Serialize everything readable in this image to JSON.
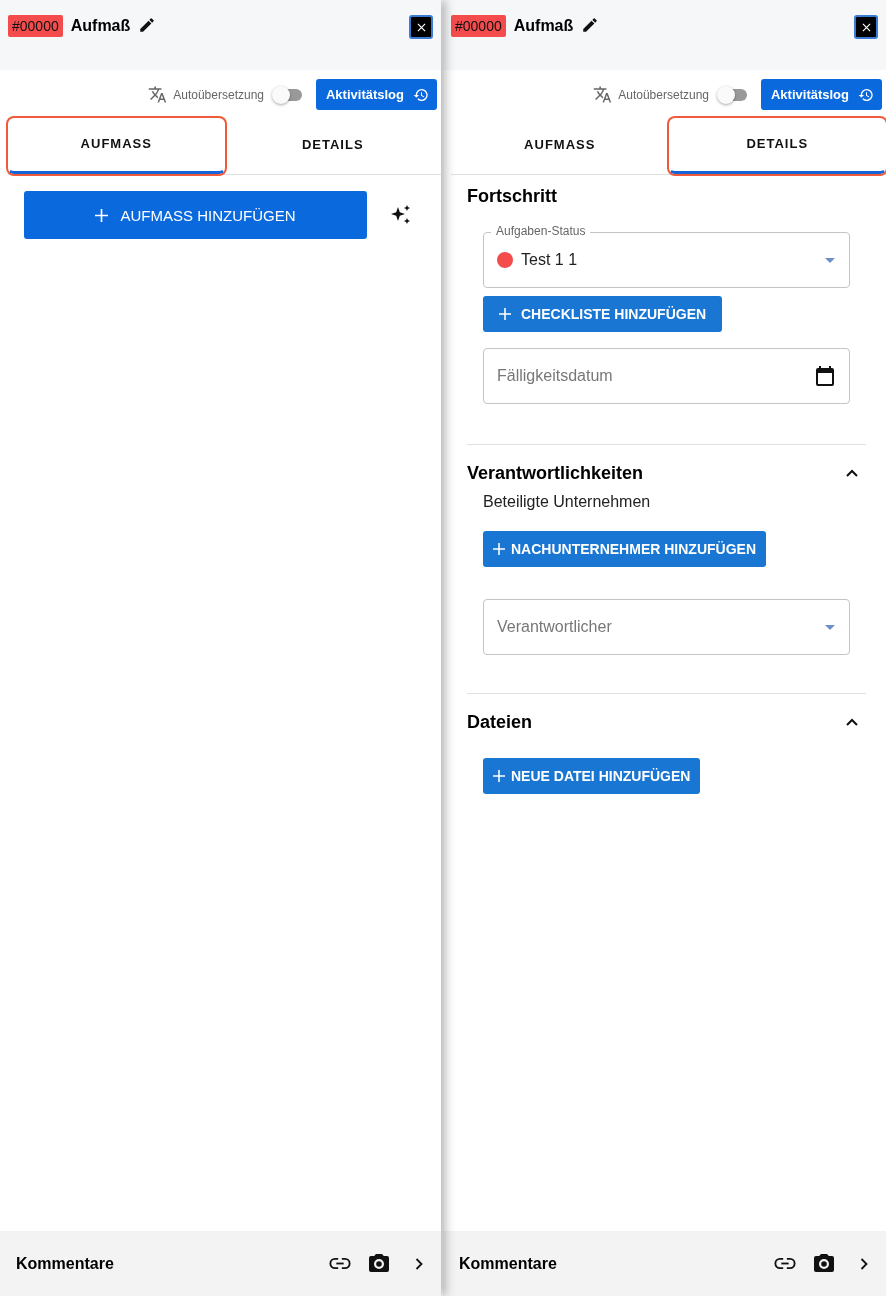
{
  "panels": [
    {
      "badge": "#00000",
      "title": "Aufmaß",
      "autotranslate": {
        "label": "Autoübersetzung",
        "on": false
      },
      "activity_button": "Aktivitätslog",
      "tabs": [
        {
          "label": "AUFMASS",
          "selected": true
        },
        {
          "label": "DETAILS",
          "selected": false
        }
      ],
      "content": {
        "kind": "aufmass",
        "add_button": "AUFMASS HINZUFÜGEN"
      },
      "footer": {
        "label": "Kommentare"
      }
    },
    {
      "badge": "#00000",
      "title": "Aufmaß",
      "autotranslate": {
        "label": "Autoübersetzung",
        "on": false
      },
      "activity_button": "Aktivitätslog",
      "tabs": [
        {
          "label": "AUFMASS",
          "selected": false
        },
        {
          "label": "DETAILS",
          "selected": true
        }
      ],
      "content": {
        "kind": "details",
        "sections": [
          {
            "title": "Fortschritt",
            "items": [
              {
                "kind": "select",
                "label": "Aufgaben-Status",
                "value": "Test 1 1",
                "color": "#f44c4c"
              },
              {
                "kind": "button",
                "label": "CHECKLISTE HINZUFÜGEN"
              },
              {
                "kind": "date",
                "placeholder": "Fälligkeitsdatum"
              }
            ]
          },
          {
            "title": "Verantwortlichkeiten",
            "expanded": true,
            "items": [
              {
                "kind": "text",
                "text": "Beteiligte Unternehmen"
              },
              {
                "kind": "button",
                "label": "NACHUNTERNEHMER HINZUFÜGEN"
              },
              {
                "kind": "select",
                "placeholder": "Verantwortlicher"
              }
            ]
          },
          {
            "title": "Dateien",
            "expanded": true,
            "items": [
              {
                "kind": "button",
                "label": "NEUE DATEI HINZUFÜGEN"
              }
            ]
          }
        ]
      },
      "footer": {
        "label": "Kommentare"
      }
    }
  ]
}
